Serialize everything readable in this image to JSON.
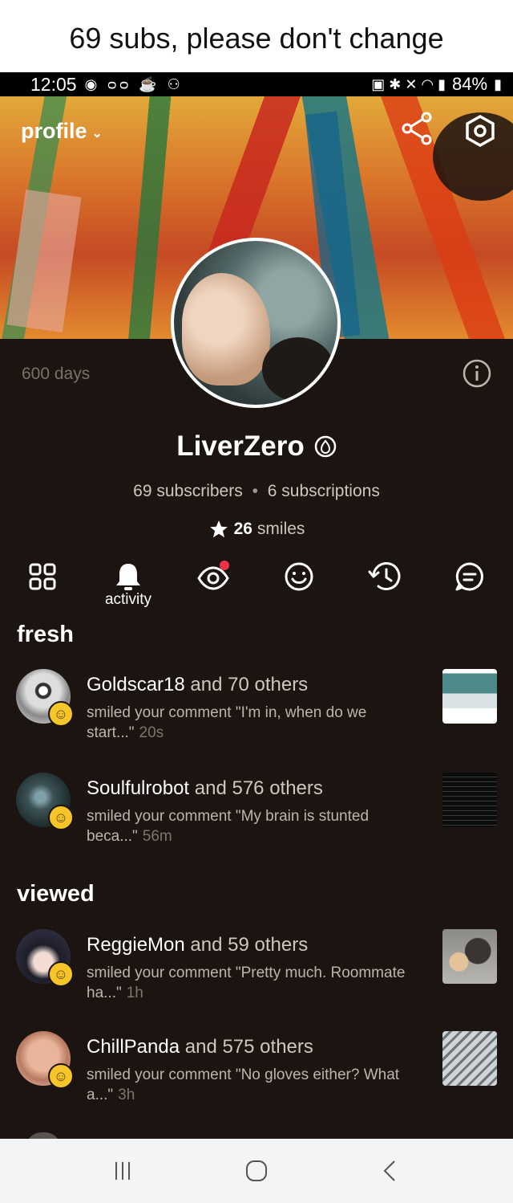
{
  "caption": "69 subs, please don't change",
  "status": {
    "time": "12:05",
    "battery": "84%"
  },
  "header": {
    "title": "profile"
  },
  "profile": {
    "days": "600 days",
    "username": "LiverZero",
    "subscribers": "69 subscribers",
    "subscriptions": "6 subscriptions",
    "smiles_count": "26",
    "smiles_label": "smiles"
  },
  "tabs": [
    {
      "icon": "grid-icon"
    },
    {
      "icon": "bell-icon",
      "label": "activity"
    },
    {
      "icon": "eye-icon"
    },
    {
      "icon": "smile-icon"
    },
    {
      "icon": "history-icon"
    },
    {
      "icon": "chat-icon"
    }
  ],
  "sections": {
    "fresh": "fresh",
    "viewed": "viewed"
  },
  "notifications": [
    {
      "user": "Goldscar18",
      "and": "and 70 others",
      "text": "smiled your comment \"I'm in, when do we start...\"",
      "ago": "20s"
    },
    {
      "user": "Soulfulrobot",
      "and": "and 576 others",
      "text": "smiled your comment \"My brain is stunted beca...\"",
      "ago": "56m"
    },
    {
      "user": "ReggieMon",
      "and": "and 59 others",
      "text": "smiled your comment \"Pretty much. Roommate ha...\"",
      "ago": "1h"
    },
    {
      "user": "ChillPanda",
      "and": "and 575 others",
      "text": "smiled your comment \"No gloves either? What a...\"",
      "ago": "3h"
    }
  ],
  "colors": {
    "background": "#1c1410",
    "accent_dot": "#e8334a",
    "smile_badge": "#f6c52a"
  }
}
